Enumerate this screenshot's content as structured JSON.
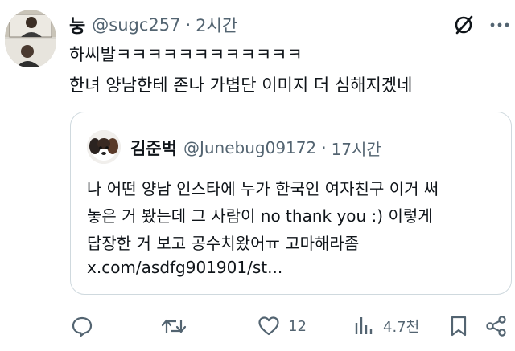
{
  "post": {
    "author_name": "눙",
    "handle": "@sugc257",
    "separator": "·",
    "time": "2시간",
    "lines": [
      "하씨발ㅋㅋㅋㅋㅋㅋㅋㅋㅋㅋㅋㅋ",
      "한녀 양남한테 존나 가볍단 이미지 더 심해지겠네"
    ]
  },
  "quote": {
    "author_name": "김준벅",
    "handle": "@Junebug09172",
    "separator": "·",
    "time": "17시간",
    "lines": [
      "나 어떤 양남 인스타에 누가 한국인 여자친구 이거 써",
      "놓은 거 봤는데 그 사람이 no thank you :) 이렇게",
      "답장한 거 보고 공수치왔어ㅠ 고마해라좀",
      "x.com/asdfg901901/st..."
    ]
  },
  "actions": {
    "reply_icon": "reply-icon",
    "repost_icon": "repost-icon",
    "like_icon": "heart-icon",
    "like_count": "12",
    "views_icon": "analytics-icon",
    "views_count": "4.7천",
    "bookmark_icon": "bookmark-icon",
    "share_icon": "share-icon"
  },
  "colors": {
    "text": "#0f1419",
    "secondary": "#536471",
    "border": "#cfd9de"
  }
}
